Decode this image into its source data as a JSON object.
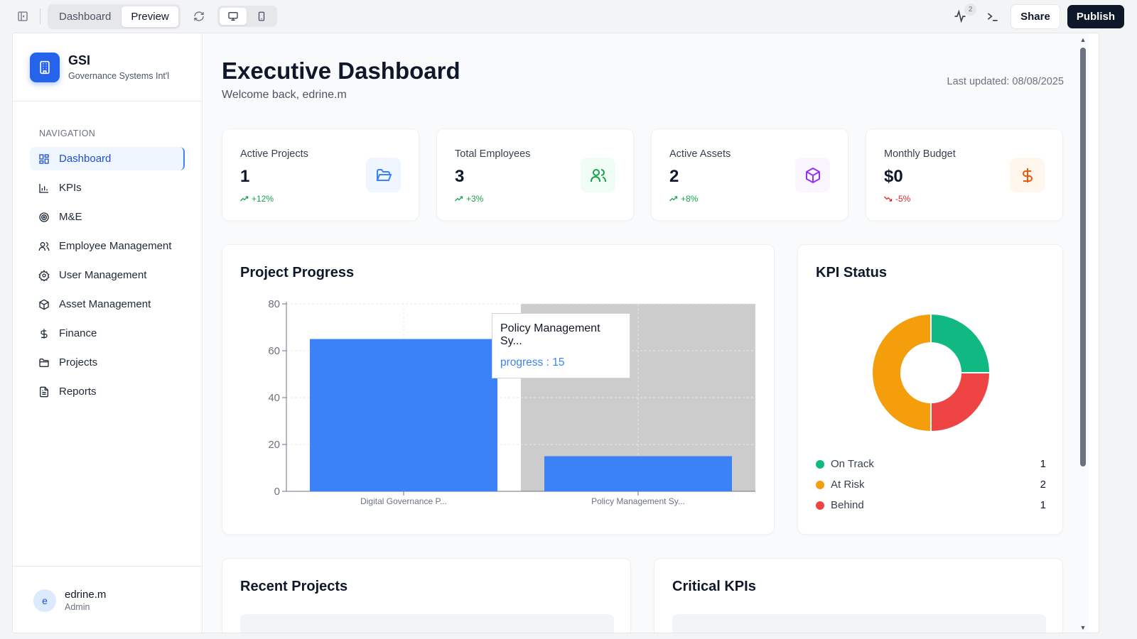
{
  "toolbar": {
    "tabs": [
      "Dashboard",
      "Preview"
    ],
    "active_tab": "Preview",
    "activity_count": "2",
    "share_label": "Share",
    "publish_label": "Publish"
  },
  "sidebar": {
    "brand_name": "GSI",
    "brand_subtitle": "Governance Systems Int'l",
    "nav_heading": "NAVIGATION",
    "items": [
      {
        "label": "Dashboard",
        "icon": "layout-grid-icon",
        "active": true
      },
      {
        "label": "KPIs",
        "icon": "bar-chart-icon"
      },
      {
        "label": "M&E",
        "icon": "target-icon"
      },
      {
        "label": "Employee Management",
        "icon": "users-icon"
      },
      {
        "label": "User Management",
        "icon": "gear-icon"
      },
      {
        "label": "Asset Management",
        "icon": "box-icon"
      },
      {
        "label": "Finance",
        "icon": "dollar-icon"
      },
      {
        "label": "Projects",
        "icon": "folder-icon"
      },
      {
        "label": "Reports",
        "icon": "file-text-icon"
      }
    ],
    "user": {
      "initial": "e",
      "name": "edrine.m",
      "role": "Admin"
    }
  },
  "header": {
    "title": "Executive Dashboard",
    "welcome": "Welcome back, edrine.m",
    "last_updated": "Last updated: 08/08/2025"
  },
  "stats": [
    {
      "label": "Active Projects",
      "value": "1",
      "trend": "+12%",
      "direction": "up",
      "icon": "folder-open-icon",
      "color": "#3b82f6",
      "bg": "#eff6ff"
    },
    {
      "label": "Total Employees",
      "value": "3",
      "trend": "+3%",
      "direction": "up",
      "icon": "users-icon",
      "color": "#16a34a",
      "bg": "#f0fdf4"
    },
    {
      "label": "Active Assets",
      "value": "2",
      "trend": "+8%",
      "direction": "up",
      "icon": "box-icon",
      "color": "#9333ea",
      "bg": "#faf5ff"
    },
    {
      "label": "Monthly Budget",
      "value": "$0",
      "trend": "-5%",
      "direction": "down",
      "icon": "dollar-icon",
      "color": "#ea580c",
      "bg": "#fff7ed"
    }
  ],
  "project_progress": {
    "title": "Project Progress",
    "tooltip": {
      "title": "Policy Management Sy...",
      "value": "progress : 15"
    }
  },
  "kpi_status": {
    "title": "KPI Status",
    "legend": [
      {
        "label": "On Track",
        "count": "1",
        "color": "#10b981"
      },
      {
        "label": "At Risk",
        "count": "2",
        "color": "#f59e0b"
      },
      {
        "label": "Behind",
        "count": "1",
        "color": "#ef4444"
      }
    ]
  },
  "sections": {
    "recent_projects": "Recent Projects",
    "critical_kpis": "Critical KPIs"
  },
  "chart_data": [
    {
      "type": "bar",
      "categories": [
        "Digital Governance P...",
        "Policy Management Sy..."
      ],
      "series": [
        {
          "values": [
            65,
            15
          ]
        }
      ],
      "ylim": [
        0,
        80
      ],
      "yticks": [
        0,
        20,
        40,
        60,
        80
      ],
      "grid": true,
      "highlighted_category": "Policy Management Sy...",
      "bar_color": "#3b82f6"
    },
    {
      "type": "pie",
      "donut": true,
      "categories": [
        "On Track",
        "Behind",
        "At Risk"
      ],
      "values": [
        1,
        1,
        2
      ],
      "colors": [
        "#10b981",
        "#ef4444",
        "#f59e0b"
      ]
    }
  ]
}
